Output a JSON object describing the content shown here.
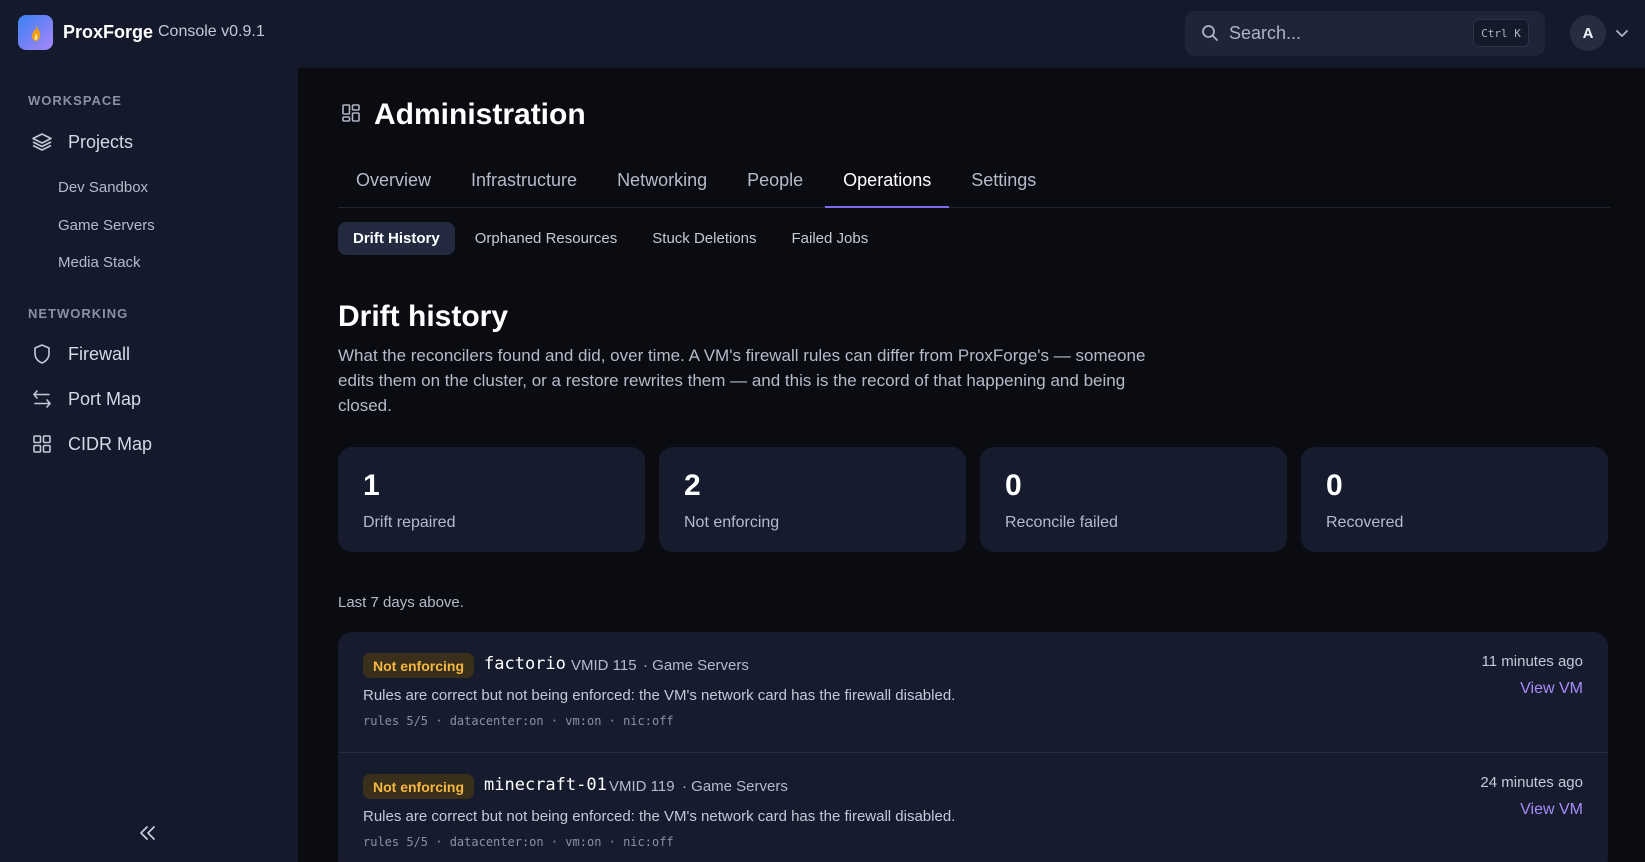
{
  "app": {
    "brand": "ProxForge",
    "version": "Console v0.9.1"
  },
  "search": {
    "placeholder": "Search...",
    "shortcut": "Ctrl K"
  },
  "user": {
    "initial": "A"
  },
  "sidebar": {
    "sections": [
      {
        "label": "WORKSPACE"
      },
      {
        "label": "NETWORKING"
      }
    ],
    "projects_label": "Projects",
    "project_items": [
      "Dev Sandbox",
      "Game Servers",
      "Media Stack"
    ],
    "networking_items": [
      "Firewall",
      "Port Map",
      "CIDR Map"
    ]
  },
  "page": {
    "title": "Administration",
    "tabs": [
      "Overview",
      "Infrastructure",
      "Networking",
      "People",
      "Operations",
      "Settings"
    ],
    "active_tab": "Operations",
    "subtabs": [
      "Drift History",
      "Orphaned Resources",
      "Stuck Deletions",
      "Failed Jobs"
    ],
    "active_subtab": "Drift History"
  },
  "drift": {
    "title": "Drift history",
    "description": "What the reconcilers found and did, over time. A VM's firewall rules can differ from ProxForge's — someone edits them on the cluster, or a restore rewrites them — and this is the record of that happening and being closed.",
    "stats": [
      {
        "value": "1",
        "label": "Drift repaired"
      },
      {
        "value": "2",
        "label": "Not enforcing"
      },
      {
        "value": "0",
        "label": "Reconcile failed"
      },
      {
        "value": "0",
        "label": "Recovered"
      }
    ],
    "range_note": "Last 7 days above.",
    "events": [
      {
        "status": "Not enforcing",
        "vm": "factorio",
        "vmid": "VMID 115",
        "project": "· Game Servers",
        "description": "Rules are correct but not being enforced: the VM's network card has the firewall disabled.",
        "meta": "rules 5/5 · datacenter:on · vm:on · nic:off",
        "time": "11 minutes ago",
        "link": "View VM"
      },
      {
        "status": "Not enforcing",
        "vm": "minecraft-01",
        "vmid": "VMID 119",
        "project": "· Game Servers",
        "description": "Rules are correct but not being enforced: the VM's network card has the firewall disabled.",
        "meta": "rules 5/5 · datacenter:on · vm:on · nic:off",
        "time": "24 minutes ago",
        "link": "View VM"
      }
    ]
  },
  "colors": {
    "accent": "#7c6cf0",
    "link": "#a78bfa",
    "warning": "#f5b841",
    "sidebar_bg": "#141a2b",
    "main_bg": "#0b0c12",
    "card_bg": "#161c2e"
  },
  "icons": {
    "logo": "flame-icon",
    "search": "search-icon",
    "projects": "layers-icon",
    "firewall": "shield-icon",
    "port_map": "arrows-swap-icon",
    "cidr_map": "grid-icon",
    "page": "dashboard-icon",
    "collapse": "double-chevron-left-icon"
  }
}
